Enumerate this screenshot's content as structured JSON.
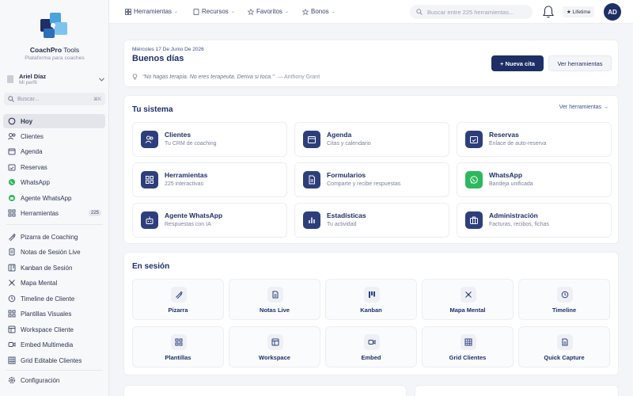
{
  "sidebar": {
    "brand_bold": "CoachPro",
    "brand_light": " Tools",
    "tagline": "Plataforma para coaches",
    "user": {
      "name": "Ariel Díaz",
      "role": "Mi perfil"
    },
    "search": {
      "placeholder": "Buscar...",
      "shortcut": "⌘K"
    },
    "items": [
      {
        "label": "Hoy",
        "icon": "home-icon"
      },
      {
        "label": "Clientes",
        "icon": "users-icon"
      },
      {
        "label": "Agenda",
        "icon": "calendar-icon"
      },
      {
        "label": "Reservas",
        "icon": "calendar-check-icon"
      },
      {
        "label": "WhatsApp",
        "icon": "whatsapp-icon"
      },
      {
        "label": "Agente WhatsApp",
        "icon": "bot-icon"
      },
      {
        "label": "Herramientas",
        "icon": "grid-icon",
        "badge": "225"
      },
      {
        "label": "Pizarra de Coaching",
        "icon": "brush-icon"
      },
      {
        "label": "Notas de Sesión Live",
        "icon": "note-icon"
      },
      {
        "label": "Kanban de Sesión",
        "icon": "kanban-icon"
      },
      {
        "label": "Mapa Mental",
        "icon": "mindmap-icon"
      },
      {
        "label": "Timeline de Cliente",
        "icon": "clock-icon"
      },
      {
        "label": "Plantillas Visuales",
        "icon": "template-icon"
      },
      {
        "label": "Workspace Cliente",
        "icon": "workspace-icon"
      },
      {
        "label": "Embed Multimedia",
        "icon": "video-icon"
      },
      {
        "label": "Grid Editable Clientes",
        "icon": "table-icon"
      },
      {
        "label": "Configuración",
        "icon": "gear-icon"
      }
    ]
  },
  "topbar": {
    "nav": [
      {
        "label": "Herramientas",
        "icon": "grid-icon"
      },
      {
        "label": "Recursos",
        "icon": "book-icon"
      },
      {
        "label": "Favoritos",
        "icon": "star-icon"
      },
      {
        "label": "Bonos",
        "icon": "star-icon"
      }
    ],
    "search_placeholder": "Buscar entre 225 herramientas...",
    "lifetime": "★ Lifetime",
    "avatar": "AD"
  },
  "hero": {
    "date": "Miércoles 17 De Junio De 2026",
    "greeting": "Buenos días",
    "quote": "\"No hagas terapia. No eres terapeuta. Deriva si toca.\"",
    "quote_author": "— Anthony Grant",
    "primary_button": "+ Nueva cita",
    "secondary_button": "Ver herramientas"
  },
  "sistema": {
    "title": "Tu sistema",
    "link": "Ver herramientas →",
    "tiles": [
      {
        "title": "Clientes",
        "subtitle": "Tu CRM de coaching",
        "icon": "users-icon"
      },
      {
        "title": "Agenda",
        "subtitle": "Citas y calendario",
        "icon": "calendar-icon"
      },
      {
        "title": "Reservas",
        "subtitle": "Enlace de auto-reserva",
        "icon": "calendar-check-icon"
      },
      {
        "title": "Herramientas",
        "subtitle": "225 interactivas",
        "icon": "grid-icon"
      },
      {
        "title": "Formularios",
        "subtitle": "Comparte y recibe respuestas",
        "icon": "form-icon"
      },
      {
        "title": "WhatsApp",
        "subtitle": "Bandeja unificada",
        "icon": "whatsapp-icon",
        "color": "#2cb85c"
      },
      {
        "title": "Agente WhatsApp",
        "subtitle": "Respuestas con IA",
        "icon": "bot-icon"
      },
      {
        "title": "Estadísticas",
        "subtitle": "Tu actividad",
        "icon": "chart-icon"
      },
      {
        "title": "Administración",
        "subtitle": "Facturas, recibos, fichas",
        "icon": "briefcase-icon"
      }
    ]
  },
  "sesion": {
    "title": "En sesión",
    "tiles": [
      {
        "label": "Pizarra",
        "icon": "brush-icon"
      },
      {
        "label": "Notas Live",
        "icon": "note-icon"
      },
      {
        "label": "Kanban",
        "icon": "kanban-icon"
      },
      {
        "label": "Mapa Mental",
        "icon": "mindmap-icon"
      },
      {
        "label": "Timeline",
        "icon": "clock-icon"
      },
      {
        "label": "Plantillas",
        "icon": "template-icon"
      },
      {
        "label": "Workspace",
        "icon": "workspace-icon"
      },
      {
        "label": "Embed",
        "icon": "video-icon"
      },
      {
        "label": "Grid Clientes",
        "icon": "table-icon"
      },
      {
        "label": "Quick Capture",
        "icon": "form-icon"
      }
    ]
  },
  "colors": {
    "primary": "#1e2f66",
    "accent": "#3d4f8c",
    "whatsapp": "#2cb85c"
  }
}
